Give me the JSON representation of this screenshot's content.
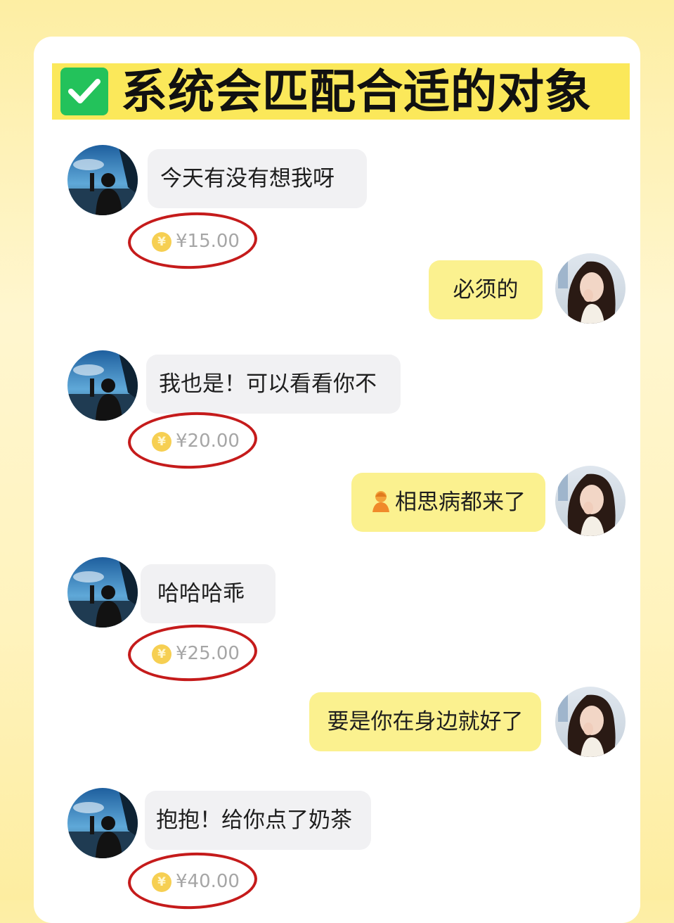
{
  "header": {
    "title": "系统会匹配合适的对象",
    "check_icon": "green-checkmark-icon",
    "check_color": "#23c25b",
    "highlight_color": "#fbe85a"
  },
  "chat": {
    "messages": [
      {
        "side": "left",
        "text": "今天有没有想我呀",
        "price": "¥15.00"
      },
      {
        "side": "right",
        "text": "必须的"
      },
      {
        "side": "left",
        "text": "我也是！可以看看你不",
        "price": "¥20.00"
      },
      {
        "side": "right",
        "text": "相思病都来了",
        "emoji": "person-emoji-icon"
      },
      {
        "side": "left",
        "text": "哈哈哈乖",
        "price": "¥25.00"
      },
      {
        "side": "right",
        "text": "要是你在身边就好了"
      },
      {
        "side": "left",
        "text": "抱抱！给你点了奶茶",
        "price": "¥40.00"
      }
    ],
    "incoming_bubble_color": "#f1f1f3",
    "outgoing_bubble_color": "#fbf18f",
    "highlight_ring_color": "#c51b1b"
  }
}
